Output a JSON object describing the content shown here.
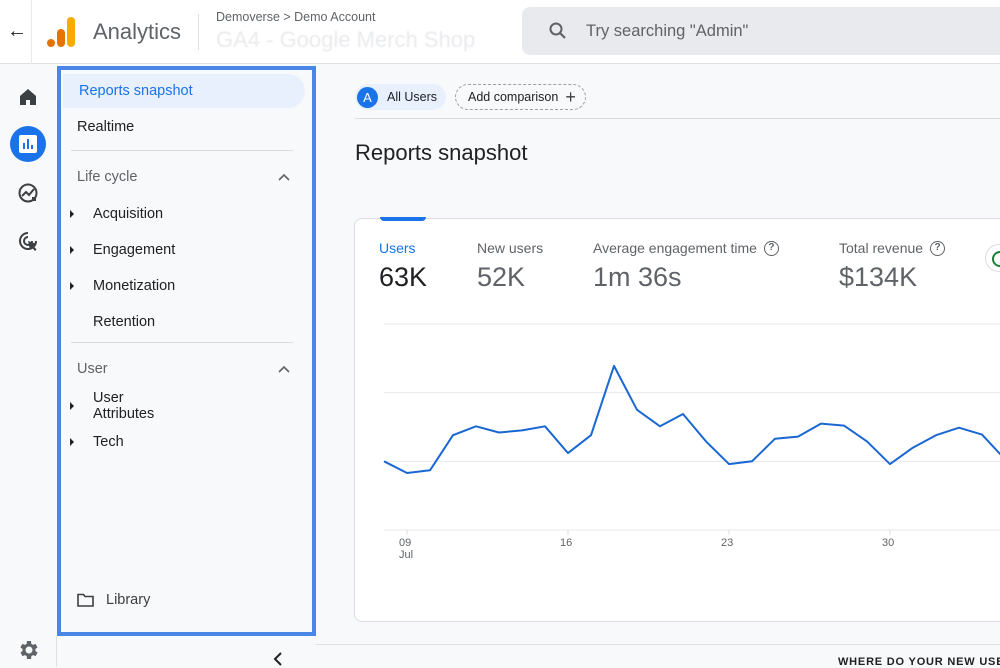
{
  "header": {
    "back_icon": "arrow-left-icon",
    "app_title": "Analytics",
    "breadcrumb": "Demoverse > Demo Account",
    "property_name": "GA4 - Google Merch Shop",
    "search_placeholder": "Try searching \"Admin\""
  },
  "rail": {
    "items": [
      {
        "icon": "home-icon",
        "active": false
      },
      {
        "icon": "reports-icon",
        "active": true
      },
      {
        "icon": "explore-icon",
        "active": false
      },
      {
        "icon": "advertising-icon",
        "active": false
      }
    ],
    "settings_icon": "gear-icon"
  },
  "nav": {
    "top_items": [
      {
        "label": "Reports snapshot",
        "active": true
      },
      {
        "label": "Realtime",
        "active": false
      }
    ],
    "sections": [
      {
        "title": "Life cycle",
        "expanded": true,
        "items": [
          {
            "label": "Acquisition",
            "expandable": true
          },
          {
            "label": "Engagement",
            "expandable": true
          },
          {
            "label": "Monetization",
            "expandable": true
          },
          {
            "label": "Retention",
            "expandable": false
          }
        ]
      },
      {
        "title": "User",
        "expanded": true,
        "items": [
          {
            "label": "User Attributes",
            "expandable": true
          },
          {
            "label": "Tech",
            "expandable": true
          }
        ]
      }
    ],
    "library_label": "Library",
    "collapse_icon": "chevron-left-icon"
  },
  "comparison": {
    "segment_avatar": "A",
    "segment_label": "All Users",
    "add_label": "Add comparison",
    "add_icon": "+"
  },
  "page": {
    "title": "Reports snapshot",
    "bottom_heading": "WHERE DO YOUR NEW USE"
  },
  "metrics": [
    {
      "label": "Users",
      "value": "63K",
      "active": true,
      "help": false
    },
    {
      "label": "New users",
      "value": "52K",
      "active": false,
      "help": false
    },
    {
      "label": "Average engagement time",
      "value": "1m 36s",
      "active": false,
      "help": true
    },
    {
      "label": "Total revenue",
      "value": "$134K",
      "active": false,
      "help": true
    }
  ],
  "chart_data": {
    "type": "line",
    "title": "",
    "xlabel": "",
    "ylabel": "",
    "series": [
      {
        "name": "Users",
        "color": "#1967d2",
        "x": [
          8,
          9,
          10,
          11,
          12,
          13,
          14,
          15,
          16,
          17,
          18,
          19,
          20,
          21,
          22,
          23,
          24,
          25,
          26,
          27,
          28,
          29,
          30,
          31,
          32,
          33,
          34,
          35
        ],
        "values": [
          1.0,
          0.83,
          0.87,
          1.38,
          1.51,
          1.42,
          1.45,
          1.51,
          1.12,
          1.38,
          2.39,
          1.75,
          1.51,
          1.69,
          1.29,
          0.96,
          1.0,
          1.33,
          1.36,
          1.55,
          1.52,
          1.29,
          0.96,
          1.2,
          1.38,
          1.49,
          1.39,
          1.03
        ]
      }
    ],
    "x_ticks": [
      {
        "x": 9,
        "label": "09",
        "sublabel": "Jul"
      },
      {
        "x": 16,
        "label": "16",
        "sublabel": ""
      },
      {
        "x": 23,
        "label": "23",
        "sublabel": ""
      },
      {
        "x": 30,
        "label": "30",
        "sublabel": ""
      }
    ],
    "ylim": [
      0,
      3
    ],
    "y_gridlines": [
      0,
      1,
      2,
      3
    ],
    "y_tick_labels_visible": false,
    "grid": true
  },
  "icons": {
    "search": "search-icon",
    "status": "check-circle-icon"
  },
  "colors": {
    "accent": "#1a73e8",
    "nav_highlight_border": "#4a86e8",
    "line": "#1967d2"
  }
}
